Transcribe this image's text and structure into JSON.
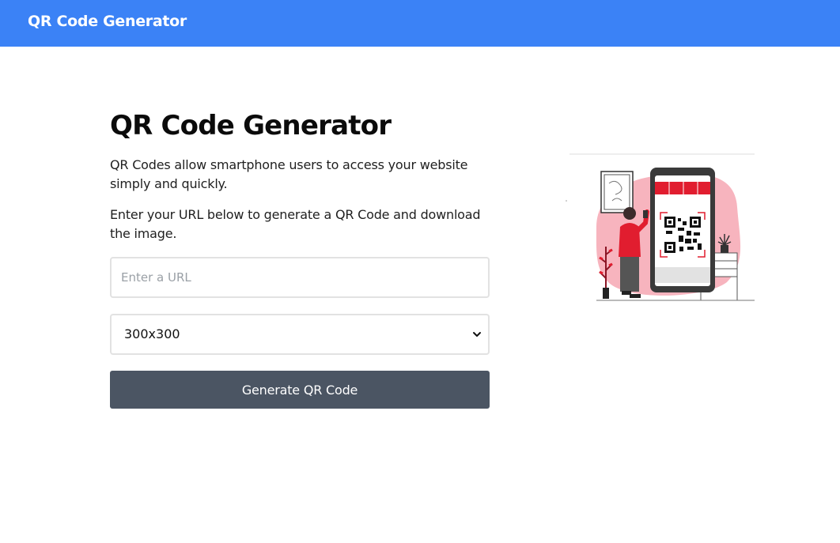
{
  "navbar": {
    "brand": "QR Code Generator"
  },
  "main": {
    "title": "QR Code Generator",
    "intro": "QR Codes allow smartphone users to access your website simply and quickly.",
    "instructions": "Enter your URL below to generate a QR Code and download the image.",
    "url_input": {
      "placeholder": "Enter a URL",
      "value": ""
    },
    "size_select": {
      "selected": "300x300",
      "icon": "chevron-down-icon"
    },
    "generate_button": {
      "label": "Generate QR Code"
    }
  },
  "illustration": {
    "icon": "qr-scan-illustration"
  },
  "colors": {
    "navbar_bg": "#3b82f6",
    "button_bg": "#4b5563",
    "accent_red": "#e11d2f",
    "accent_pink": "#f7b4be"
  }
}
